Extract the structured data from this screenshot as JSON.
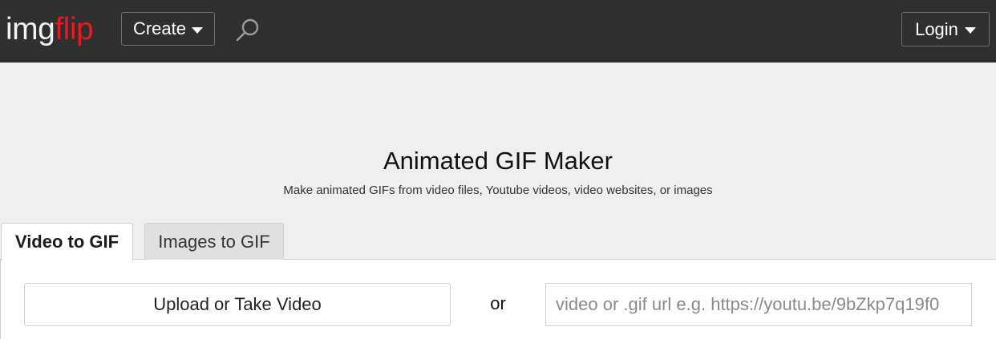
{
  "header": {
    "logo_img": "img",
    "logo_flip": "flip",
    "create_label": "Create",
    "login_label": "Login",
    "search_icon": "search-icon",
    "colors": {
      "bar": "#2f2f2f",
      "logo_accent": "#e21c21"
    }
  },
  "main": {
    "title": "Animated GIF Maker",
    "subtitle": "Make animated GIFs from video files, Youtube videos, video websites, or images",
    "tabs": [
      {
        "label": "Video to GIF",
        "active": true
      },
      {
        "label": "Images to GIF",
        "active": false
      }
    ],
    "upload_label": "Upload or Take Video",
    "or_label": "or",
    "url_placeholder": "video or .gif url e.g. https://youtu.be/9bZkp7q19f0"
  }
}
